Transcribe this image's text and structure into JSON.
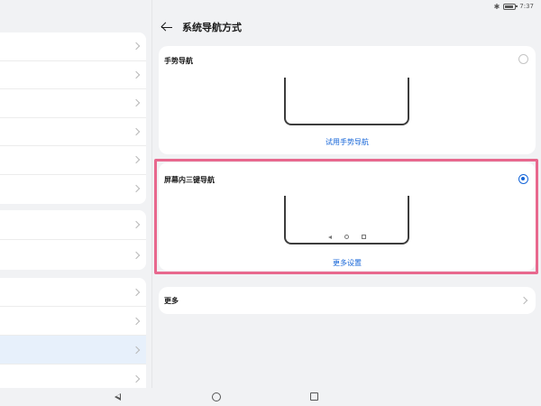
{
  "status_bar": {
    "time": "7:37",
    "bluetooth_icon": "bluetooth-icon",
    "battery_icon": "battery-icon"
  },
  "header": {
    "title": "系统导航方式",
    "back_icon": "back-arrow-icon"
  },
  "gesture_nav": {
    "title": "手势导航",
    "selected": false,
    "link": "试用手势导航"
  },
  "three_key_nav": {
    "title": "屏幕内三键导航",
    "selected": true,
    "link": "更多设置"
  },
  "more": {
    "label": "更多"
  },
  "colors": {
    "accent": "#1565d8",
    "highlight": "#e8688e",
    "selected_row": "#e7f0fb"
  }
}
